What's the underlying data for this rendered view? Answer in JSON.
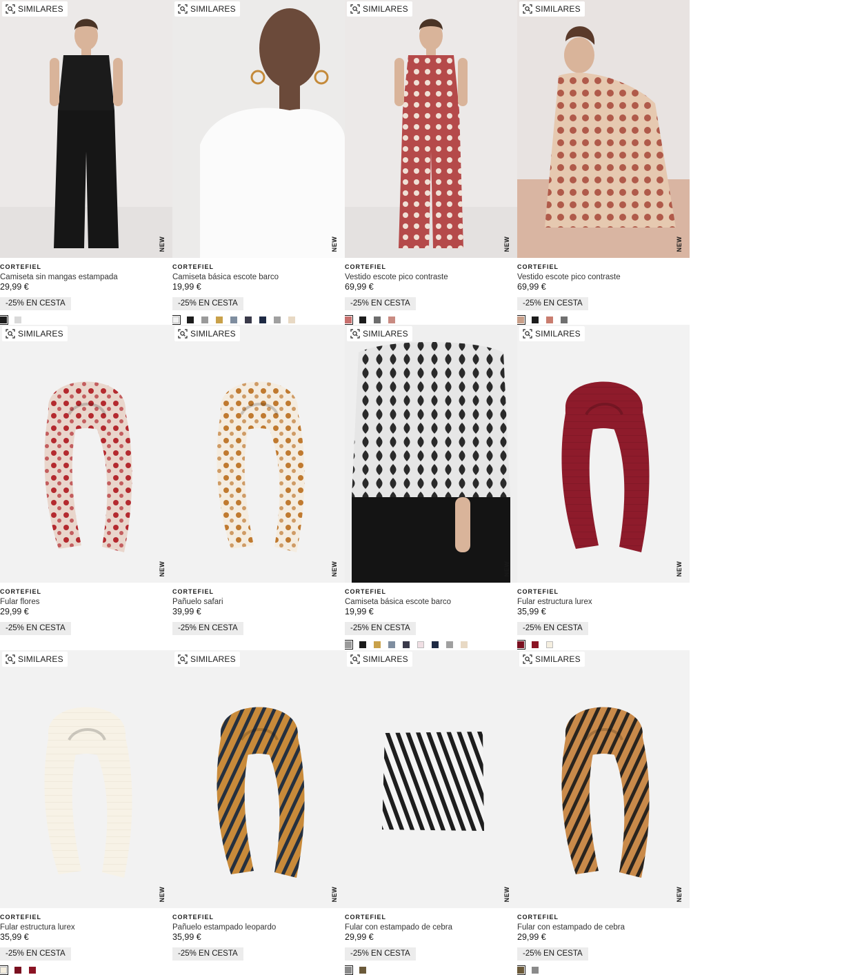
{
  "similar_label": "SIMILARES",
  "new_label": "NEW",
  "products": [
    {
      "brand": "CORTEFIEL",
      "name": "Camiseta sin mangas estampada",
      "price": "29,99 €",
      "promo": "-25% EN CESTA",
      "image": "model-black-outfit",
      "swatches": [
        "#1c1c1c",
        "#d9d9d9"
      ]
    },
    {
      "brand": "CORTEFIEL",
      "name": "Camiseta básica escote barco",
      "price": "19,99 €",
      "promo": "-25% EN CESTA",
      "image": "model-white-top",
      "swatches": [
        "#f2f2f2",
        "#1c1c1c",
        "#9a9a9a",
        "#c9a14a",
        "#7f8ea0",
        "#3a3a4a",
        "#1e2a44",
        "#a0a0a0",
        "#e8d9c4"
      ]
    },
    {
      "brand": "CORTEFIEL",
      "name": "Vestido escote pico contraste",
      "price": "69,99 €",
      "promo": "-25% EN CESTA",
      "image": "model-red-dress",
      "swatches": [
        "#c8706e",
        "#1c1c1c",
        "#6d6d6d",
        "#c98b82"
      ]
    },
    {
      "brand": "CORTEFIEL",
      "name": "Vestido escote pico contraste",
      "price": "69,99 €",
      "promo": "-25% EN CESTA",
      "image": "model-paisley-dress",
      "swatches": [
        "#c9a08a",
        "#1c1c1c",
        "#c97d6f",
        "#707070"
      ]
    },
    {
      "brand": "CORTEFIEL",
      "name": "Fular flores",
      "price": "29,99 €",
      "promo": "-25% EN CESTA",
      "image": "scarf-floral-red",
      "swatches": []
    },
    {
      "brand": "CORTEFIEL",
      "name": "Pañuelo safari",
      "price": "39,99 €",
      "promo": "-25% EN CESTA",
      "image": "scarf-safari",
      "swatches": []
    },
    {
      "brand": "CORTEFIEL",
      "name": "Camiseta básica escote barco",
      "price": "19,99 €",
      "promo": "-25% EN CESTA",
      "image": "model-print-top",
      "swatches": [
        "#9a9a9a",
        "#1c1c1c",
        "#c9a14a",
        "#7f8ea0",
        "#3a3a4a",
        "#f0dfe4",
        "#1e2a44",
        "#a0a0a0",
        "#e8d9c4"
      ]
    },
    {
      "brand": "CORTEFIEL",
      "name": "Fular estructura lurex",
      "price": "35,99 €",
      "promo": "-25% EN CESTA",
      "image": "scarf-burgundy",
      "swatches": [
        "#7a1020",
        "#8b1424",
        "#f5efe0"
      ]
    },
    {
      "brand": "CORTEFIEL",
      "name": "Fular estructura lurex",
      "price": "35,99 €",
      "promo": "-25% EN CESTA",
      "image": "scarf-cream",
      "swatches": [
        "#f5efe0",
        "#7a1020",
        "#8b1424"
      ]
    },
    {
      "brand": "CORTEFIEL",
      "name": "Pañuelo estampado leopardo",
      "price": "35,99 €",
      "promo": "-25% EN CESTA",
      "image": "scarf-leopard-silk",
      "swatches": []
    },
    {
      "brand": "CORTEFIEL",
      "name": "Fular con estampado de cebra",
      "price": "29,99 €",
      "promo": "-25% EN CESTA",
      "image": "scarf-zebra",
      "swatches": [
        "#8a8a8a",
        "#6b5a3a"
      ]
    },
    {
      "brand": "CORTEFIEL",
      "name": "Fular con estampado de cebra",
      "price": "29,99 €",
      "promo": "-25% EN CESTA",
      "image": "scarf-tiger",
      "swatches": [
        "#6b5a3a",
        "#8a8a8a"
      ]
    }
  ]
}
